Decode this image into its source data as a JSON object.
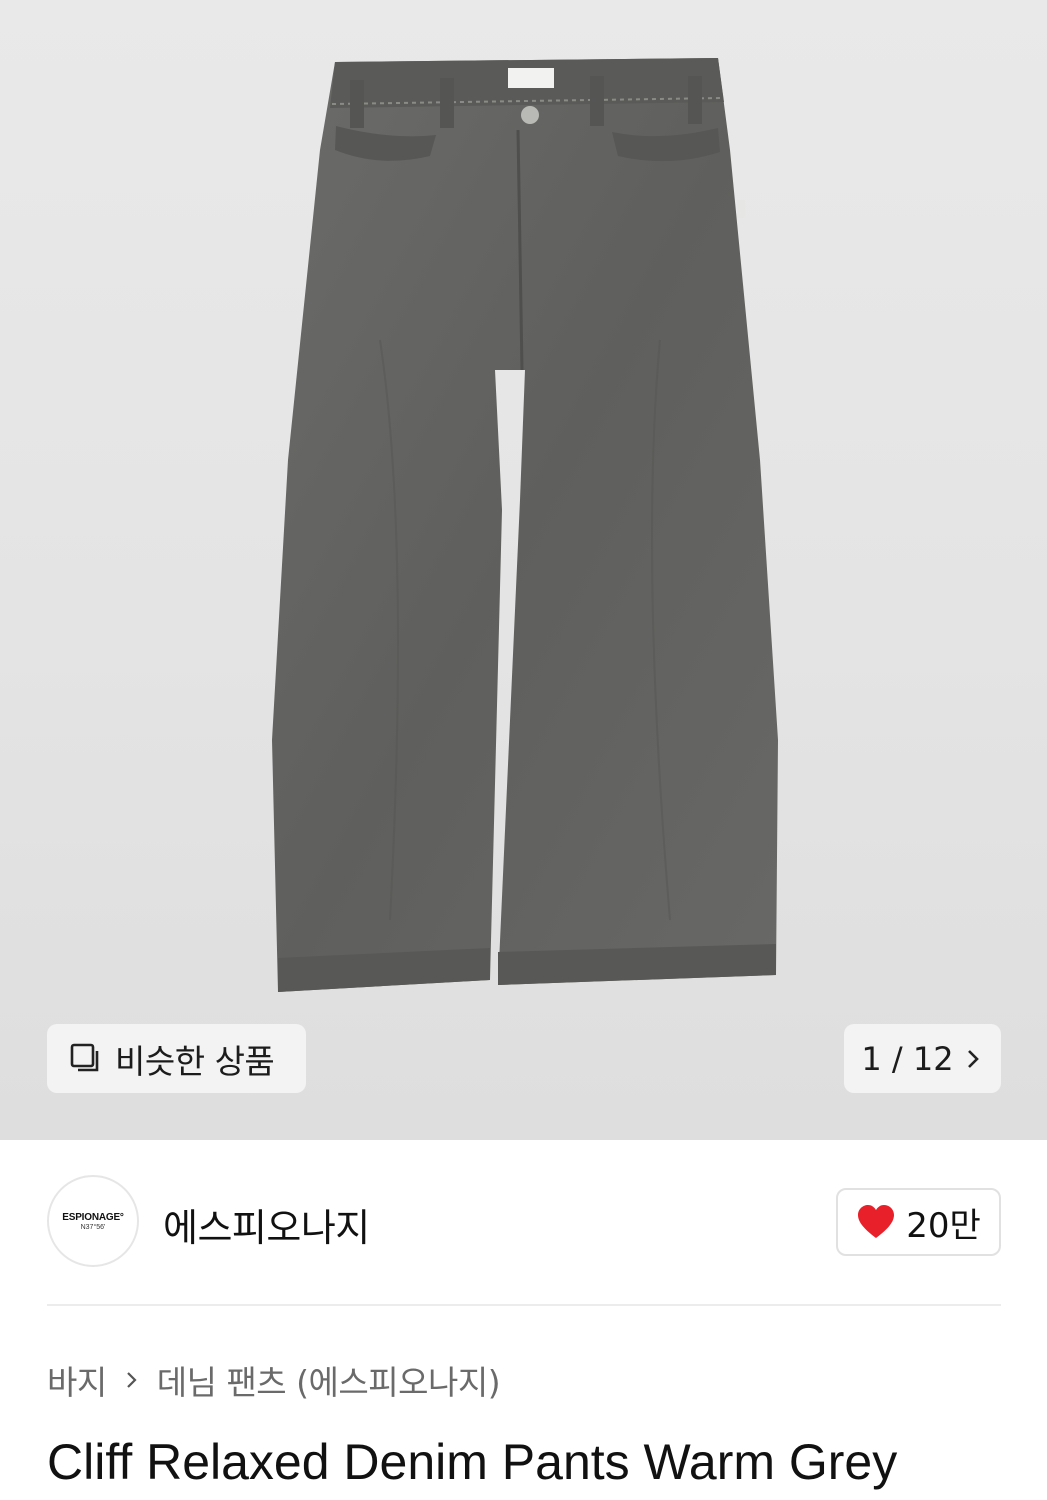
{
  "gallery": {
    "similar_label": "비슷한 상품",
    "counter": "1 / 12",
    "similar_icon": "stacked-squares-icon",
    "next_icon": "chevron-right-icon"
  },
  "brand": {
    "logo_line1": "ESPIONAGE°",
    "logo_line2": "N37°56'",
    "name": "에스피오나지",
    "like_count": "20만",
    "like_icon": "heart-icon",
    "heart_color": "#e8202a"
  },
  "breadcrumb": {
    "category": "바지",
    "subcategory": "데님 팬츠 (에스피오나지)"
  },
  "product": {
    "title": "Cliff Relaxed Denim Pants Warm Grey"
  }
}
